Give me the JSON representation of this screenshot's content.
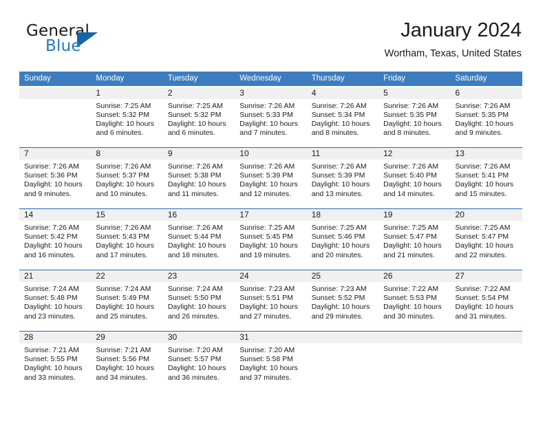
{
  "brand": {
    "word_one": "General",
    "word_two": "Blue",
    "triangle_icon": "triangle-icon"
  },
  "header": {
    "title": "January 2024",
    "location": "Wortham, Texas, United States"
  },
  "calendar": {
    "weekdays": [
      "Sunday",
      "Monday",
      "Tuesday",
      "Wednesday",
      "Thursday",
      "Friday",
      "Saturday"
    ],
    "colors": {
      "header_blue": "#3d7dbf",
      "row_rule_blue": "#1f6cb5",
      "day_band_gray": "#f0f0f0",
      "brand_blue": "#1f7ac4"
    },
    "weeks": [
      [
        {
          "day": "",
          "sunrise": "",
          "sunset": "",
          "daylight_line1": "",
          "daylight_line2": ""
        },
        {
          "day": "1",
          "sunrise": "Sunrise: 7:25 AM",
          "sunset": "Sunset: 5:32 PM",
          "daylight_line1": "Daylight: 10 hours",
          "daylight_line2": "and 6 minutes."
        },
        {
          "day": "2",
          "sunrise": "Sunrise: 7:25 AM",
          "sunset": "Sunset: 5:32 PM",
          "daylight_line1": "Daylight: 10 hours",
          "daylight_line2": "and 6 minutes."
        },
        {
          "day": "3",
          "sunrise": "Sunrise: 7:26 AM",
          "sunset": "Sunset: 5:33 PM",
          "daylight_line1": "Daylight: 10 hours",
          "daylight_line2": "and 7 minutes."
        },
        {
          "day": "4",
          "sunrise": "Sunrise: 7:26 AM",
          "sunset": "Sunset: 5:34 PM",
          "daylight_line1": "Daylight: 10 hours",
          "daylight_line2": "and 8 minutes."
        },
        {
          "day": "5",
          "sunrise": "Sunrise: 7:26 AM",
          "sunset": "Sunset: 5:35 PM",
          "daylight_line1": "Daylight: 10 hours",
          "daylight_line2": "and 8 minutes."
        },
        {
          "day": "6",
          "sunrise": "Sunrise: 7:26 AM",
          "sunset": "Sunset: 5:35 PM",
          "daylight_line1": "Daylight: 10 hours",
          "daylight_line2": "and 9 minutes."
        }
      ],
      [
        {
          "day": "7",
          "sunrise": "Sunrise: 7:26 AM",
          "sunset": "Sunset: 5:36 PM",
          "daylight_line1": "Daylight: 10 hours",
          "daylight_line2": "and 9 minutes."
        },
        {
          "day": "8",
          "sunrise": "Sunrise: 7:26 AM",
          "sunset": "Sunset: 5:37 PM",
          "daylight_line1": "Daylight: 10 hours",
          "daylight_line2": "and 10 minutes."
        },
        {
          "day": "9",
          "sunrise": "Sunrise: 7:26 AM",
          "sunset": "Sunset: 5:38 PM",
          "daylight_line1": "Daylight: 10 hours",
          "daylight_line2": "and 11 minutes."
        },
        {
          "day": "10",
          "sunrise": "Sunrise: 7:26 AM",
          "sunset": "Sunset: 5:39 PM",
          "daylight_line1": "Daylight: 10 hours",
          "daylight_line2": "and 12 minutes."
        },
        {
          "day": "11",
          "sunrise": "Sunrise: 7:26 AM",
          "sunset": "Sunset: 5:39 PM",
          "daylight_line1": "Daylight: 10 hours",
          "daylight_line2": "and 13 minutes."
        },
        {
          "day": "12",
          "sunrise": "Sunrise: 7:26 AM",
          "sunset": "Sunset: 5:40 PM",
          "daylight_line1": "Daylight: 10 hours",
          "daylight_line2": "and 14 minutes."
        },
        {
          "day": "13",
          "sunrise": "Sunrise: 7:26 AM",
          "sunset": "Sunset: 5:41 PM",
          "daylight_line1": "Daylight: 10 hours",
          "daylight_line2": "and 15 minutes."
        }
      ],
      [
        {
          "day": "14",
          "sunrise": "Sunrise: 7:26 AM",
          "sunset": "Sunset: 5:42 PM",
          "daylight_line1": "Daylight: 10 hours",
          "daylight_line2": "and 16 minutes."
        },
        {
          "day": "15",
          "sunrise": "Sunrise: 7:26 AM",
          "sunset": "Sunset: 5:43 PM",
          "daylight_line1": "Daylight: 10 hours",
          "daylight_line2": "and 17 minutes."
        },
        {
          "day": "16",
          "sunrise": "Sunrise: 7:26 AM",
          "sunset": "Sunset: 5:44 PM",
          "daylight_line1": "Daylight: 10 hours",
          "daylight_line2": "and 18 minutes."
        },
        {
          "day": "17",
          "sunrise": "Sunrise: 7:25 AM",
          "sunset": "Sunset: 5:45 PM",
          "daylight_line1": "Daylight: 10 hours",
          "daylight_line2": "and 19 minutes."
        },
        {
          "day": "18",
          "sunrise": "Sunrise: 7:25 AM",
          "sunset": "Sunset: 5:46 PM",
          "daylight_line1": "Daylight: 10 hours",
          "daylight_line2": "and 20 minutes."
        },
        {
          "day": "19",
          "sunrise": "Sunrise: 7:25 AM",
          "sunset": "Sunset: 5:47 PM",
          "daylight_line1": "Daylight: 10 hours",
          "daylight_line2": "and 21 minutes."
        },
        {
          "day": "20",
          "sunrise": "Sunrise: 7:25 AM",
          "sunset": "Sunset: 5:47 PM",
          "daylight_line1": "Daylight: 10 hours",
          "daylight_line2": "and 22 minutes."
        }
      ],
      [
        {
          "day": "21",
          "sunrise": "Sunrise: 7:24 AM",
          "sunset": "Sunset: 5:48 PM",
          "daylight_line1": "Daylight: 10 hours",
          "daylight_line2": "and 23 minutes."
        },
        {
          "day": "22",
          "sunrise": "Sunrise: 7:24 AM",
          "sunset": "Sunset: 5:49 PM",
          "daylight_line1": "Daylight: 10 hours",
          "daylight_line2": "and 25 minutes."
        },
        {
          "day": "23",
          "sunrise": "Sunrise: 7:24 AM",
          "sunset": "Sunset: 5:50 PM",
          "daylight_line1": "Daylight: 10 hours",
          "daylight_line2": "and 26 minutes."
        },
        {
          "day": "24",
          "sunrise": "Sunrise: 7:23 AM",
          "sunset": "Sunset: 5:51 PM",
          "daylight_line1": "Daylight: 10 hours",
          "daylight_line2": "and 27 minutes."
        },
        {
          "day": "25",
          "sunrise": "Sunrise: 7:23 AM",
          "sunset": "Sunset: 5:52 PM",
          "daylight_line1": "Daylight: 10 hours",
          "daylight_line2": "and 29 minutes."
        },
        {
          "day": "26",
          "sunrise": "Sunrise: 7:22 AM",
          "sunset": "Sunset: 5:53 PM",
          "daylight_line1": "Daylight: 10 hours",
          "daylight_line2": "and 30 minutes."
        },
        {
          "day": "27",
          "sunrise": "Sunrise: 7:22 AM",
          "sunset": "Sunset: 5:54 PM",
          "daylight_line1": "Daylight: 10 hours",
          "daylight_line2": "and 31 minutes."
        }
      ],
      [
        {
          "day": "28",
          "sunrise": "Sunrise: 7:21 AM",
          "sunset": "Sunset: 5:55 PM",
          "daylight_line1": "Daylight: 10 hours",
          "daylight_line2": "and 33 minutes."
        },
        {
          "day": "29",
          "sunrise": "Sunrise: 7:21 AM",
          "sunset": "Sunset: 5:56 PM",
          "daylight_line1": "Daylight: 10 hours",
          "daylight_line2": "and 34 minutes."
        },
        {
          "day": "30",
          "sunrise": "Sunrise: 7:20 AM",
          "sunset": "Sunset: 5:57 PM",
          "daylight_line1": "Daylight: 10 hours",
          "daylight_line2": "and 36 minutes."
        },
        {
          "day": "31",
          "sunrise": "Sunrise: 7:20 AM",
          "sunset": "Sunset: 5:58 PM",
          "daylight_line1": "Daylight: 10 hours",
          "daylight_line2": "and 37 minutes."
        },
        {
          "day": "",
          "sunrise": "",
          "sunset": "",
          "daylight_line1": "",
          "daylight_line2": ""
        },
        {
          "day": "",
          "sunrise": "",
          "sunset": "",
          "daylight_line1": "",
          "daylight_line2": ""
        },
        {
          "day": "",
          "sunrise": "",
          "sunset": "",
          "daylight_line1": "",
          "daylight_line2": ""
        }
      ]
    ]
  }
}
